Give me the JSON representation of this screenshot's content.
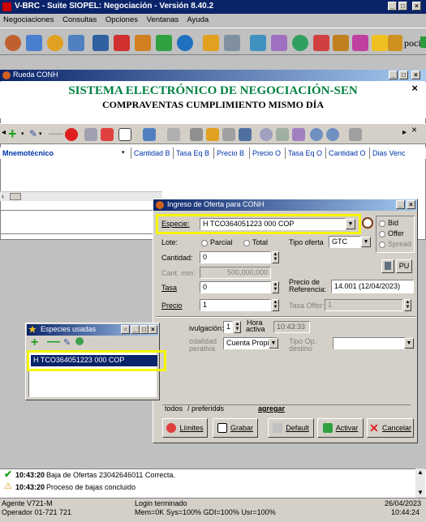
{
  "main_window": {
    "title": "V-BRC - Suite SIOPEL: Negociación - Versión 8.40.2",
    "menu": [
      "Negociaciones",
      "Consultas",
      "Opciones",
      "Ventanas",
      "Ayuda"
    ],
    "toolbar_overflow_text": "poci"
  },
  "rueda": {
    "title": "Rueda CONH",
    "header_line1": "SISTEMA ELECTRÓNICO DE NEGOCIACIÓN-SEN",
    "header_line2": "COMPRAVENTAS CUMPLIMIENTO MISMO DÍA",
    "close_x": "×",
    "columns": [
      "Mnemotécnico",
      "Cantidad B",
      "Tasa Eq B",
      "Precio B",
      "Precio O",
      "Tasa Eq O",
      "Cantidad O",
      "Dias Venc"
    ]
  },
  "oferta": {
    "title": "Ingreso de Oferta para CONH",
    "especie_label": "Especie:",
    "especie_value": "H TCO364051223 000 COP",
    "bid_label": "Bid",
    "offer_label": "Offer",
    "spread_label": "Spread",
    "lote_label": "Lote:",
    "parcial_label": "Parcial",
    "total_label": "Total",
    "tipo_oferta_label": "Tipo oferta",
    "tipo_oferta_value": "GTC",
    "cantidad_label": "Cantidad:",
    "cantidad_value": "0",
    "cant_min_label": "Cant. mín:",
    "cant_min_value": "500,000,000",
    "pu_label": "PU",
    "tasa_label": "Tasa",
    "tasa_value": "0",
    "precio_ref_label1": "Precio de",
    "precio_ref_label2": "Referencia:",
    "precio_ref_value": "14.001 (12/04/2023)",
    "precio_label": "Precio",
    "precio_value": "1",
    "tasa_offer_label": "Tasa Offer:",
    "tasa_offer_value": "1",
    "divulgacion_label": "ivulgación:",
    "divulgacion_value": "1",
    "hora_activa_label1": "Hora",
    "hora_activa_label2": "activa",
    "hora_activa_value": "10:43:33",
    "modalidad_label1": "odalidad",
    "modalidad_label2": "perativa",
    "modalidad_value": "Cuenta Propia",
    "tipo_op_label1": "Tipo Op.",
    "tipo_op_label2": "destino",
    "tipo_op_value": "",
    "tab_todos": "todos",
    "tab_preferidos": "preferidos",
    "agregar_label": "agregar",
    "btn_limites": "Límites",
    "btn_grabar": "Grabar",
    "btn_default": "Default",
    "btn_activar": "Activar",
    "btn_cancelar": "Cancelar"
  },
  "especies_usadas": {
    "title": "Especies usadas",
    "item": "H TCO364051223 000 COP"
  },
  "log": [
    {
      "time": "10:43:20",
      "text": "Baja de Ofertas 23042646011 Correcta.",
      "status": "ok"
    },
    {
      "time": "10:43:20",
      "text": "Proceso de bajas concluido",
      "status": "warning"
    }
  ],
  "statusbar": {
    "agente": "Agente V721-M",
    "operador": "Operador 01-721 721",
    "login": "Login terminado",
    "mem": "Mem=0K Sys=100% GDI=100% Usr=100%",
    "date": "26/04/2023",
    "time": "10:44:24"
  },
  "colors": {
    "title_blue": "#0a246a",
    "header_green": "#008040",
    "highlight_yellow": "#f5f500",
    "selection": "#0a246a"
  }
}
